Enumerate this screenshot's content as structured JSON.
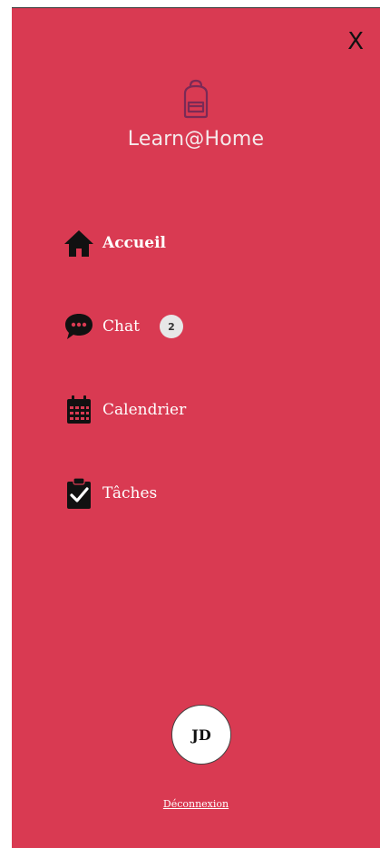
{
  "drawer": {
    "close_label": "X",
    "brand": {
      "title": "Learn@Home",
      "logo_icon": "backpack-icon"
    },
    "nav": [
      {
        "label": "Accueil",
        "icon": "home-icon",
        "active": true
      },
      {
        "label": "Chat",
        "icon": "chat-icon",
        "badge": "2"
      },
      {
        "label": "Calendrier",
        "icon": "calendar-icon"
      },
      {
        "label": "Tâches",
        "icon": "tasks-clipboard-icon"
      }
    ],
    "user": {
      "initials": "JD"
    },
    "logout_label": "Déconnexion"
  },
  "colors": {
    "drawer_bg": "#d93a52",
    "logo": "#7a2a56",
    "icon": "#111111",
    "badge_bg": "#e7e7e7"
  }
}
